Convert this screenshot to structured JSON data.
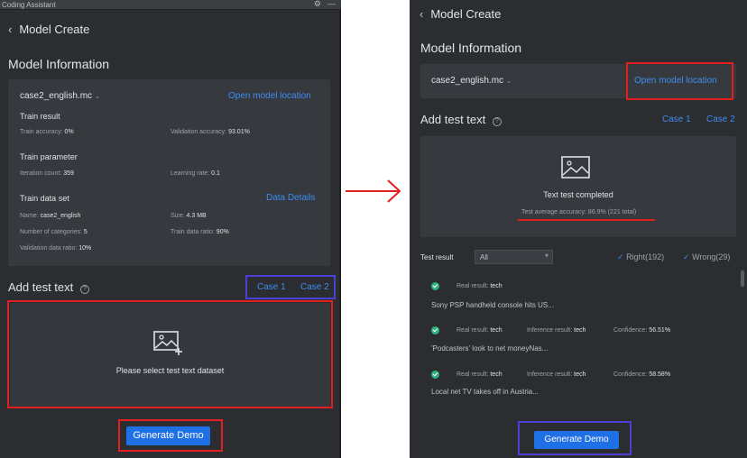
{
  "left": {
    "window_title": "Coding Assistant",
    "header": "Model Create",
    "model_info_title": "Model Information",
    "model_name": "case2_english.mc",
    "open_location": "Open model location",
    "train_result": {
      "title": "Train result",
      "train_accuracy_label": "Train accuracy:",
      "train_accuracy_value": "0%",
      "validation_accuracy_label": "Validation accuracy:",
      "validation_accuracy_value": "93.01%"
    },
    "train_parameter": {
      "title": "Train parameter",
      "iteration_label": "Iteration count:",
      "iteration_value": "359",
      "learning_rate_label": "Learning rate:",
      "learning_rate_value": "0.1"
    },
    "train_data_set": {
      "title": "Train data set",
      "data_details": "Data Details",
      "name_label": "Name:",
      "name_value": "case2_english",
      "size_label": "Size:",
      "size_value": "4.3 MB",
      "categories_label": "Number of categories:",
      "categories_value": "5",
      "train_ratio_label": "Train data ratio:",
      "train_ratio_value": "90%",
      "validation_ratio_label": "Validation data ratio:",
      "validation_ratio_value": "10%"
    },
    "add_test_title": "Add test text",
    "case1": "Case 1",
    "case2": "Case 2",
    "dataset_prompt": "Please select test text dataset",
    "generate_button": "Generate Demo"
  },
  "right": {
    "header": "Model Create",
    "model_info_title": "Model Information",
    "model_name": "case2_english.mc",
    "open_location": "Open model location",
    "add_test_title": "Add test text",
    "case1": "Case 1",
    "case2": "Case 2",
    "completed": "Text test completed",
    "avg_accuracy": "Test average accuracy: 86.9% (221 total)",
    "test_result_label": "Test result",
    "filter_value": "All",
    "right_count": "Right(192)",
    "wrong_count": "Wrong(29)",
    "results": [
      {
        "real_label": "Real result:",
        "real": "tech",
        "inference_label": "",
        "inference": "",
        "confidence_label": "",
        "confidence": "",
        "text": "Sony PSP handheld console hits US..."
      },
      {
        "real_label": "Real result:",
        "real": "tech",
        "inference_label": "Inference result:",
        "inference": "tech",
        "confidence_label": "Confidence:",
        "confidence": "56.51%",
        "text": "'Podcasters' look to net moneyNas..."
      },
      {
        "real_label": "Real result:",
        "real": "tech",
        "inference_label": "Inference result:",
        "inference": "tech",
        "confidence_label": "Confidence:",
        "confidence": "58.58%",
        "text": "Local net TV takes off in Austria..."
      }
    ],
    "generate_button": "Generate Demo"
  },
  "colors": {
    "panel_bg": "#2b2d30",
    "card_bg": "#363a3f",
    "link": "#3d8cf0",
    "button": "#1f6fe5",
    "highlight_red": "#e02020",
    "highlight_blue": "#4b3fd6",
    "success": "#2fb37f"
  },
  "icons": [
    "back-chevron-icon",
    "gear-icon",
    "minimize-icon",
    "chevron-down-icon",
    "help-icon",
    "add-image-icon",
    "image-icon",
    "check-icon",
    "success-check-icon",
    "arrow-right-icon"
  ]
}
